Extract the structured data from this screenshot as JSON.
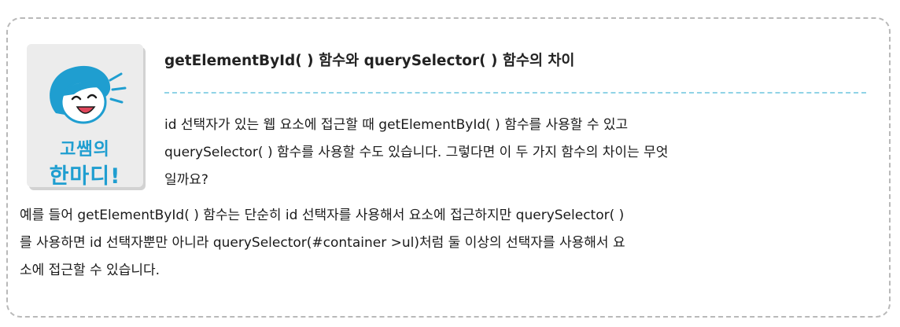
{
  "badge": {
    "line1": "고쌤의",
    "line2": "한마디!",
    "accent_color": "#1f9ed0",
    "icon": "laughing-teacher-icon"
  },
  "title": "getElementById( ) 함수와 querySelector( ) 함수의 차이",
  "paragraph1": {
    "lines": [
      "id 선택자가 있는 웹 요소에 접근할 때 getElementById( ) 함수를 사용할 수 있고",
      "querySelector( ) 함수를 사용할 수도 있습니다. 그렇다면 이 두 가지 함수의 차이는 무엇",
      "일까요?"
    ]
  },
  "paragraph2": {
    "lines": [
      "예를 들어 getElementById( ) 함수는 단순히 id 선택자를 사용해서 요소에 접근하지만 querySelector( )",
      "를 사용하면 id 선택자뿐만 아니라 querySelector(#container >ul)처럼 둘 이상의 선택자를 사용해서 요",
      "소에 접근할 수 있습니다."
    ]
  }
}
